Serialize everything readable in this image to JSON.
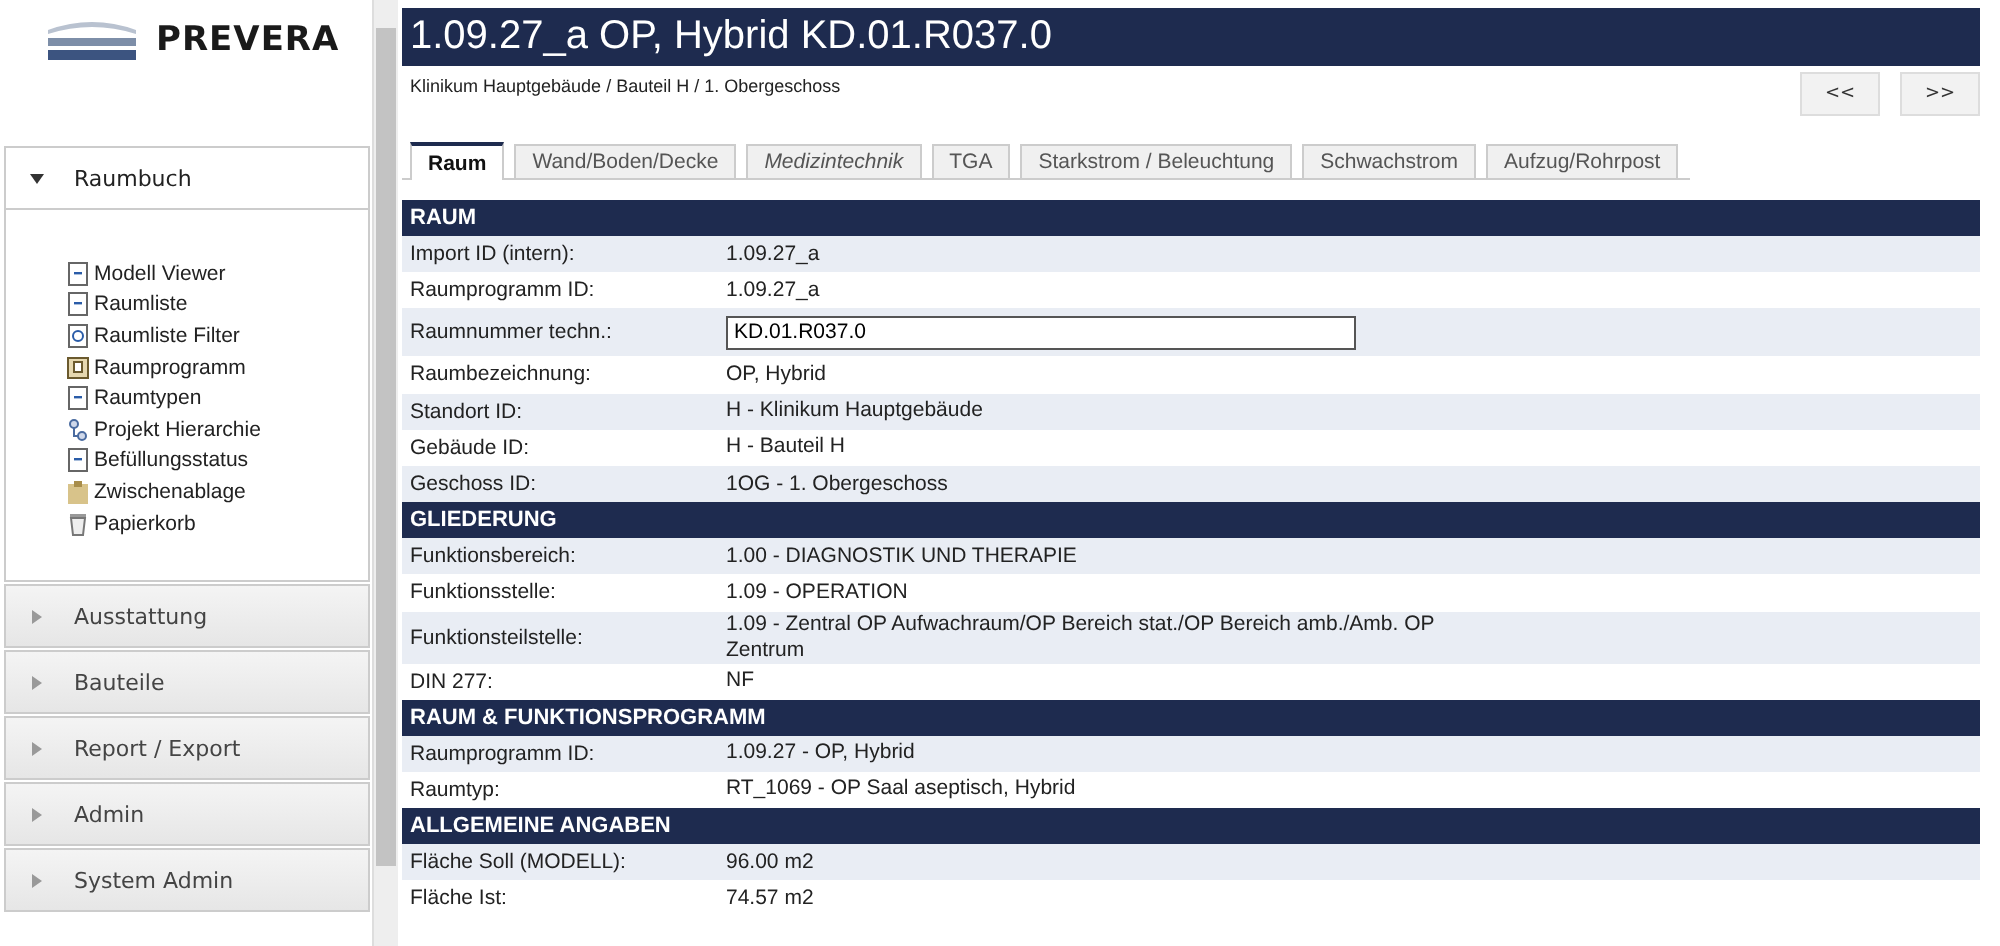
{
  "logo": {
    "text": "PREVERA"
  },
  "sidebar": {
    "sections": [
      {
        "label": "Raumbuch",
        "expanded": true,
        "items": [
          {
            "label": "Modell Viewer",
            "kind": "doc"
          },
          {
            "label": "Raumliste",
            "kind": "doc"
          },
          {
            "label": "Raumliste Filter",
            "kind": "search"
          },
          {
            "label": "Raumprogramm",
            "kind": "box"
          },
          {
            "label": "Raumtypen",
            "kind": "doc"
          },
          {
            "label": "Projekt Hierarchie",
            "kind": "tree"
          },
          {
            "label": "Befüllungsstatus",
            "kind": "doc"
          },
          {
            "label": "Zwischenablage",
            "kind": "clip"
          },
          {
            "label": "Papierkorb",
            "kind": "bin"
          }
        ]
      },
      {
        "label": "Ausstattung",
        "expanded": false
      },
      {
        "label": "Bauteile",
        "expanded": false
      },
      {
        "label": "Report / Export",
        "expanded": false
      },
      {
        "label": "Admin",
        "expanded": false
      },
      {
        "label": "System Admin",
        "expanded": false
      }
    ]
  },
  "header": {
    "title": "1.09.27_a OP, Hybrid KD.01.R037.0",
    "breadcrumb": "Klinikum Hauptgebäude / Bauteil H / 1. Obergeschoss",
    "nav_buttons": [
      "<<",
      ">>"
    ]
  },
  "tabs": [
    {
      "label": "Raum",
      "selected": true,
      "italic": false
    },
    {
      "label": "Wand/Boden/Decke",
      "selected": false,
      "italic": false
    },
    {
      "label": "Medizintechnik",
      "selected": false,
      "italic": true
    },
    {
      "label": "TGA",
      "selected": false,
      "italic": false
    },
    {
      "label": "Starkstrom / Beleuchtung",
      "selected": false,
      "italic": false
    },
    {
      "label": "Schwachstrom",
      "selected": false,
      "italic": false
    },
    {
      "label": "Aufzug/Rohrpost",
      "selected": false,
      "italic": false
    }
  ],
  "sections": [
    {
      "title": "RAUM",
      "rows": [
        {
          "label": "Import ID (intern):",
          "value": "1.09.27_a",
          "kind": "text"
        },
        {
          "label": "Raumprogramm ID:",
          "value": "1.09.27_a",
          "kind": "text"
        },
        {
          "label": "Raumnummer techn.:",
          "value": "KD.01.R037.0",
          "kind": "input"
        },
        {
          "label": "Raumbezeichnung:",
          "value": "OP, Hybrid",
          "kind": "text"
        },
        {
          "label": "Standort ID:",
          "value": "H - Klinikum Hauptgebäude",
          "kind": "text"
        },
        {
          "label": "Gebäude ID:",
          "value": "H - Bauteil H",
          "kind": "text"
        },
        {
          "label": "Geschoss ID:",
          "value": "1OG - 1. Obergeschoss",
          "kind": "text"
        }
      ]
    },
    {
      "title": "GLIEDERUNG",
      "rows": [
        {
          "label": "Funktionsbereich:",
          "value": "1.00 - DIAGNOSTIK UND THERAPIE",
          "kind": "text"
        },
        {
          "label": "Funktionsstelle:",
          "value": "1.09 - OPERATION",
          "kind": "text"
        },
        {
          "label": "Funktionsteilstelle:",
          "value": "1.09 - Zentral OP Aufwachraum/OP Bereich stat./OP Bereich amb./Amb. OP Zentrum",
          "kind": "text"
        },
        {
          "label": "DIN 277:",
          "value": "NF",
          "kind": "text"
        }
      ]
    },
    {
      "title": "RAUM & FUNKTIONSPROGRAMM",
      "rows": [
        {
          "label": "Raumprogramm ID:",
          "value": "1.09.27 - OP, Hybrid",
          "kind": "text"
        },
        {
          "label": "Raumtyp:",
          "value": "RT_1069 - OP Saal aseptisch, Hybrid",
          "kind": "text"
        }
      ]
    },
    {
      "title": "ALLGEMEINE ANGABEN",
      "rows": [
        {
          "label": "Fläche Soll (MODELL):",
          "value": "96.00 m2",
          "kind": "text"
        },
        {
          "label": "Fläche Ist:",
          "value": "74.57 m2",
          "kind": "text"
        }
      ]
    }
  ]
}
